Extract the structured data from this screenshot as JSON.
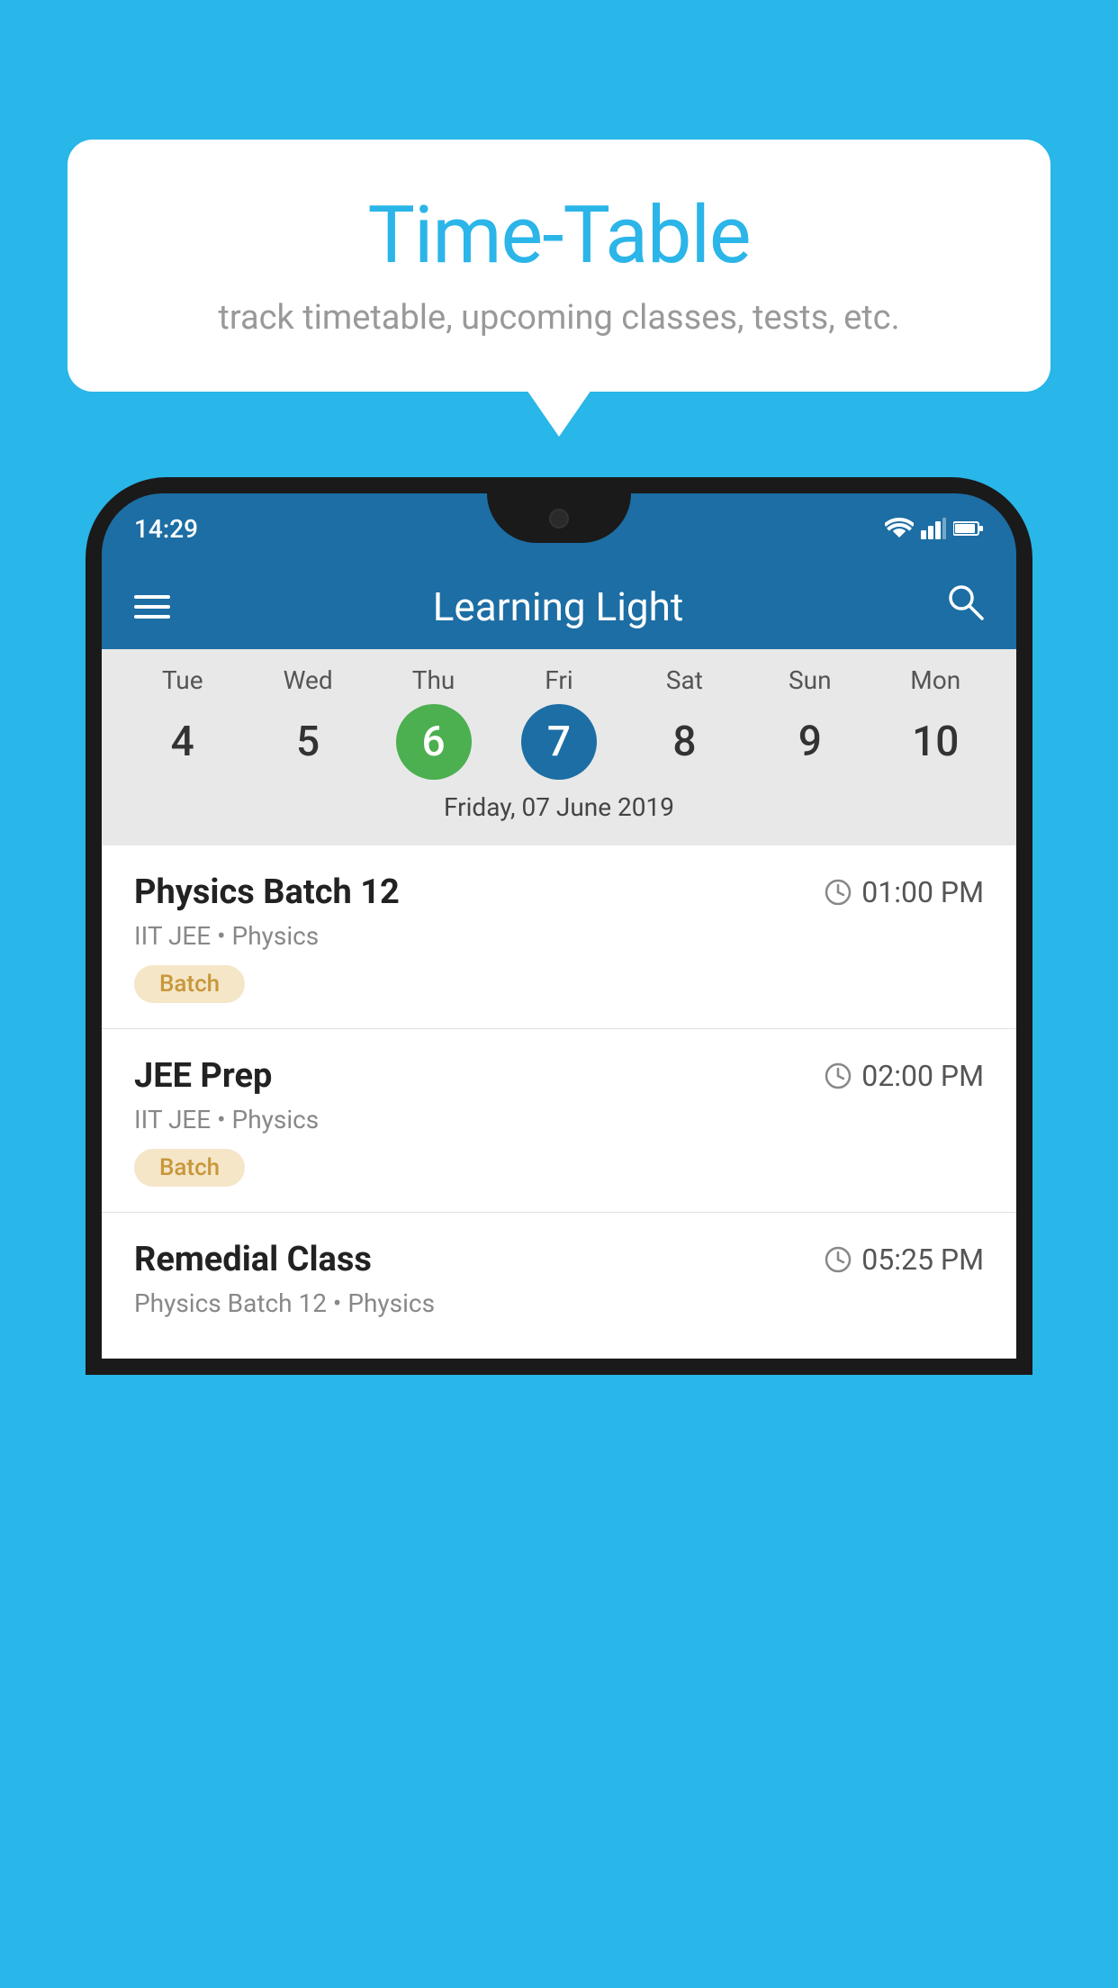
{
  "background": {
    "color": "#29b6e8"
  },
  "speech_bubble": {
    "title": "Time-Table",
    "subtitle": "track timetable, upcoming classes, tests, etc."
  },
  "phone": {
    "status_bar": {
      "time": "14:29",
      "icons": [
        "wifi",
        "signal",
        "battery"
      ]
    },
    "header": {
      "menu_icon": "hamburger",
      "title": "Learning Light",
      "search_icon": "search"
    },
    "calendar": {
      "days": [
        {
          "name": "Tue",
          "number": "4",
          "state": "normal"
        },
        {
          "name": "Wed",
          "number": "5",
          "state": "normal"
        },
        {
          "name": "Thu",
          "number": "6",
          "state": "today"
        },
        {
          "name": "Fri",
          "number": "7",
          "state": "selected"
        },
        {
          "name": "Sat",
          "number": "8",
          "state": "normal"
        },
        {
          "name": "Sun",
          "number": "9",
          "state": "normal"
        },
        {
          "name": "Mon",
          "number": "10",
          "state": "normal"
        }
      ],
      "selected_date_label": "Friday, 07 June 2019"
    },
    "schedule": [
      {
        "title": "Physics Batch 12",
        "time": "01:00 PM",
        "subtitle": "IIT JEE • Physics",
        "badge": "Batch"
      },
      {
        "title": "JEE Prep",
        "time": "02:00 PM",
        "subtitle": "IIT JEE • Physics",
        "badge": "Batch"
      },
      {
        "title": "Remedial Class",
        "time": "05:25 PM",
        "subtitle": "Physics Batch 12 • Physics",
        "badge": null
      }
    ]
  }
}
